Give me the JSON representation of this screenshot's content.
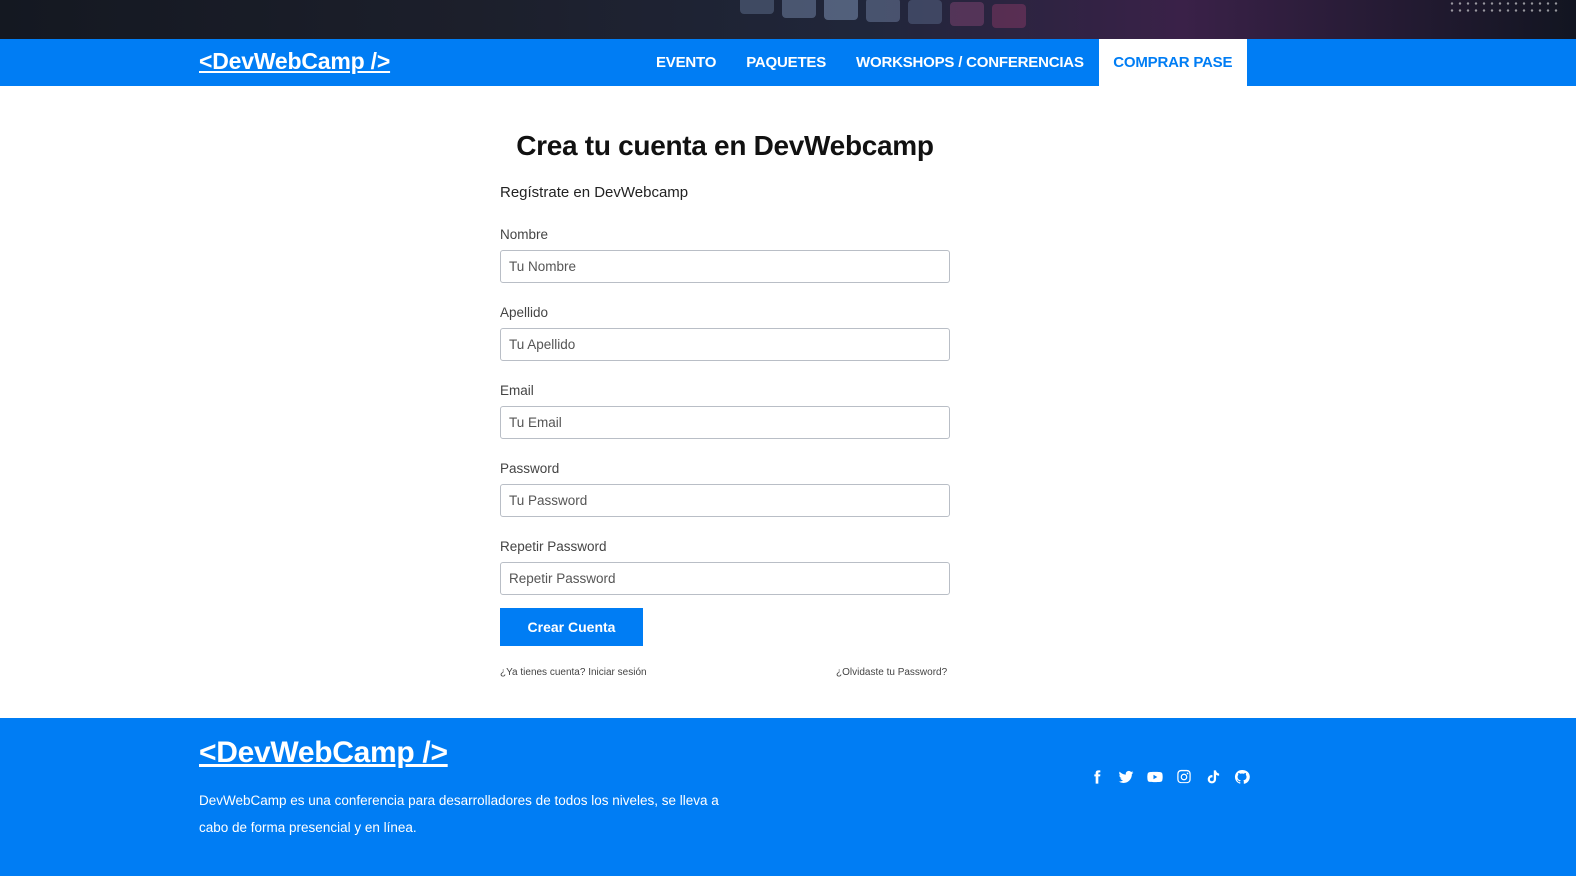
{
  "header": {
    "logo": "<DevWebCamp />",
    "nav": [
      {
        "label": "EVENTO"
      },
      {
        "label": "PAQUETES"
      },
      {
        "label": "WORKSHOPS / CONFERENCIAS"
      },
      {
        "label": "COMPRAR PASE"
      }
    ]
  },
  "form": {
    "title": "Crea tu cuenta en DevWebcamp",
    "subtitle": "Regístrate en DevWebcamp",
    "fields": [
      {
        "label": "Nombre",
        "placeholder": "Tu Nombre",
        "value": ""
      },
      {
        "label": "Apellido",
        "placeholder": "Tu Apellido",
        "value": ""
      },
      {
        "label": "Email",
        "placeholder": "Tu Email",
        "value": ""
      },
      {
        "label": "Password",
        "placeholder": "Tu Password",
        "value": ""
      },
      {
        "label": "Repetir Password",
        "placeholder": "Repetir Password",
        "value": ""
      }
    ],
    "submit_label": "Crear Cuenta",
    "login_link": "¿Ya tienes cuenta? Iniciar sesión",
    "forgot_link": "¿Olvidaste tu Password?"
  },
  "footer": {
    "logo": "<DevWebCamp />",
    "description": "DevWebCamp es una conferencia para desarrolladores de todos los niveles, se lleva a cabo de forma presencial y en línea.",
    "social_icons": [
      "facebook-icon",
      "twitter-icon",
      "youtube-icon",
      "instagram-icon",
      "tiktok-icon",
      "github-icon"
    ]
  },
  "colors": {
    "brand_blue": "#007df4",
    "white": "#ffffff"
  }
}
